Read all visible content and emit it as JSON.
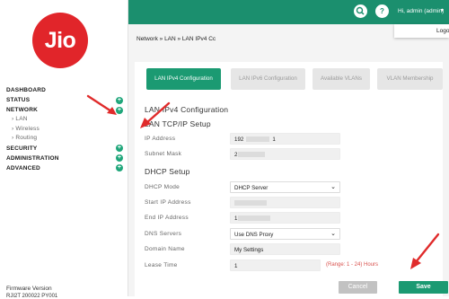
{
  "brand": {
    "logo_text": "Jio",
    "color": "#e1252a"
  },
  "sidebar": {
    "items": [
      {
        "label": "DASHBOARD",
        "plus": false
      },
      {
        "label": "STATUS",
        "plus": true
      },
      {
        "label": "NETWORK",
        "plus": true
      },
      {
        "label": "LAN",
        "sub": true
      },
      {
        "label": "Wireless",
        "sub": true
      },
      {
        "label": "Routing",
        "sub": true
      },
      {
        "label": "SECURITY",
        "plus": true
      },
      {
        "label": "ADMINISTRATION",
        "plus": true
      },
      {
        "label": "ADVANCED",
        "plus": true
      }
    ],
    "firmware_label": "Firmware Version",
    "firmware_value": "RJI2T 200022 PY001"
  },
  "header": {
    "search_icon": "search-icon",
    "help_icon": "help-icon",
    "help_glyph": "?",
    "user_text": "Hi, admin (admin)",
    "logout_label": "Logout",
    "accent": "#1b8f6e"
  },
  "breadcrumb": "Network  »  LAN  »  LAN IPv4 Cc",
  "tabs": [
    {
      "label": "LAN IPv4 Configuration",
      "active": true
    },
    {
      "label": "LAN IPv6 Configuration",
      "active": false
    },
    {
      "label": "Available VLANs",
      "active": false
    },
    {
      "label": "VLAN Membership",
      "active": false
    }
  ],
  "form": {
    "title": "LAN IPv4 Configuration",
    "tcpip_heading": "LAN TCP/IP Setup",
    "ip_address_label": "IP Address",
    "ip_address_prefix": "192",
    "ip_address_suffix": "1",
    "subnet_mask_label": "Subnet Mask",
    "subnet_mask_prefix": "2",
    "dhcp_heading": "DHCP Setup",
    "dhcp_mode_label": "DHCP Mode",
    "dhcp_mode_value": "DHCP Server",
    "start_ip_label": "Start IP Address",
    "end_ip_label": "End IP Address",
    "end_ip_prefix": "1",
    "dns_servers_label": "DNS Servers",
    "dns_servers_value": "Use DNS Proxy",
    "domain_name_label": "Domain Name",
    "domain_name_value": "My Settings",
    "lease_time_label": "Lease Time",
    "lease_time_value": "1",
    "lease_range": "(Range: 1 - 24) Hours"
  },
  "buttons": {
    "cancel": "Cancel",
    "save": "Save"
  },
  "annotation_color": "#e02b2b"
}
